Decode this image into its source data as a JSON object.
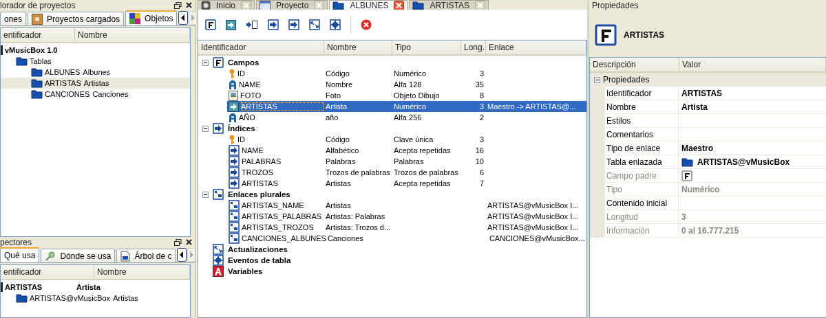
{
  "explorer": {
    "title": "lorador de proyectos",
    "tabs": [
      {
        "label": "ones",
        "selected": false,
        "kind": "plain"
      },
      {
        "label": "Proyectos cargados",
        "selected": false,
        "kind": "box"
      },
      {
        "label": "Objetos",
        "selected": true,
        "kind": "objects"
      }
    ],
    "columns": [
      "entificador",
      "Nombre"
    ],
    "tree": [
      {
        "label": "vMusicBox 1.0",
        "kind": "project",
        "selected": false,
        "children": [
          {
            "label": "Tablas",
            "kind": "folder",
            "selected": false,
            "children": [
              {
                "label": "ALBUNES",
                "name": "Albunes",
                "kind": "folder",
                "selected": false
              },
              {
                "label": "ARTISTAS",
                "name": "Artistas",
                "kind": "folder",
                "selected": true
              },
              {
                "label": "CANCIONES",
                "name": "Canciones",
                "kind": "folder",
                "selected": false
              }
            ]
          }
        ]
      }
    ]
  },
  "inspector": {
    "title": "pectores",
    "tabs": [
      {
        "label": "Qué usa",
        "selected": true,
        "kind": "plain"
      },
      {
        "label": "Dónde se usa",
        "selected": false,
        "kind": "magnifier"
      },
      {
        "label": "Árbol de c",
        "selected": false,
        "kind": "document"
      }
    ],
    "columns": [
      "entificador",
      "Nombre"
    ],
    "tree": [
      {
        "label": "ARTISTAS",
        "name": "Artista",
        "kind": "project",
        "selected": false,
        "children": [
          {
            "label": "ARTISTAS@vMusicBox",
            "name": "Artistas",
            "kind": "folder",
            "selected": false
          }
        ]
      }
    ]
  },
  "editor": {
    "tabs": [
      {
        "label": "Inicio",
        "selected": false,
        "kind": "home"
      },
      {
        "label": "Proyecto",
        "selected": false,
        "kind": "window"
      },
      {
        "label": "ALBUNES",
        "selected": true,
        "kind": "folder"
      },
      {
        "label": "ARTISTAS",
        "selected": false,
        "kind": "folder"
      }
    ],
    "columns": [
      "Identificador",
      "Nombre",
      "Tipo",
      "Long.",
      "Enlace"
    ],
    "groups": [
      {
        "label": "Campos",
        "kind": "fields",
        "rows": [
          {
            "id": "ID",
            "name": "Código",
            "type": "Numérico",
            "length": "3",
            "kind": "key",
            "selected": false
          },
          {
            "id": "NAME",
            "name": "Nombre",
            "type": "Alfa 128",
            "length": "35",
            "kind": "alpha",
            "selected": false
          },
          {
            "id": "FOTO",
            "name": "Foto",
            "type": "Objeto Dibujo",
            "length": "8",
            "kind": "picture",
            "selected": false
          },
          {
            "id": "ARTISTAS",
            "name": "Artista",
            "type": "Numérico",
            "length": "3",
            "link": "Maestro -> ARTISTAS@...",
            "kind": "link",
            "selected": true
          },
          {
            "id": "AÑO",
            "name": "año",
            "type": "Alfa 256",
            "length": "2",
            "kind": "alpha",
            "selected": false
          }
        ]
      },
      {
        "label": "Índices",
        "kind": "index",
        "rows": [
          {
            "id": "ID",
            "name": "Código",
            "type": "Clave única",
            "length": "3",
            "kind": "key",
            "selected": false
          },
          {
            "id": "NAME",
            "name": "Alfabético",
            "type": "Acepta repetidas",
            "length": "16",
            "kind": "index",
            "selected": false
          },
          {
            "id": "PALABRAS",
            "name": "Palabras",
            "type": "Palabras",
            "length": "10",
            "kind": "index",
            "selected": false
          },
          {
            "id": "TROZOS",
            "name": "Trozos de palabras",
            "type": "Trozos de palabras",
            "length": "6",
            "kind": "index",
            "selected": false
          },
          {
            "id": "ARTISTAS",
            "name": "Artistas",
            "type": "Acepta repetidas",
            "length": "7",
            "kind": "index",
            "selected": false
          }
        ]
      },
      {
        "label": "Enlaces plurales",
        "kind": "plural",
        "rows": [
          {
            "id": "ARTISTAS_NAME",
            "name": "Artistas",
            "link": "ARTISTAS@vMusicBox I...",
            "kind": "plural",
            "selected": false
          },
          {
            "id": "ARTISTAS_PALABRAS",
            "name": "Artistas: Palabras",
            "link": "ARTISTAS@vMusicBox I...",
            "kind": "plural",
            "selected": false
          },
          {
            "id": "ARTISTAS_TROZOS",
            "name": "Artistas: Trozos d...",
            "link": "ARTISTAS@vMusicBox I...",
            "kind": "plural",
            "selected": false
          },
          {
            "id": "CANCIONES_ALBUNES",
            "name": "Canciones",
            "link": "CANCIONES@vMusicBox...",
            "kind": "plural",
            "selected": false
          }
        ]
      },
      {
        "label": "Actualizaciones",
        "kind": "updates"
      },
      {
        "label": "Eventos de tabla",
        "kind": "events"
      },
      {
        "label": "Variables",
        "kind": "variables"
      }
    ]
  },
  "properties": {
    "title": "Propiedades",
    "heading": "ARTISTAS",
    "columns": [
      "Descripción",
      "Valor"
    ],
    "group": {
      "label": "Propiedades",
      "rows": [
        {
          "label": "Identificador",
          "value": "ARTISTAS",
          "kind": "text",
          "disabled": false
        },
        {
          "label": "Nombre",
          "value": "Artista",
          "kind": "text",
          "disabled": false
        },
        {
          "label": "Estilos",
          "kind": "text",
          "disabled": false
        },
        {
          "label": "Comentarios",
          "kind": "text",
          "disabled": false
        },
        {
          "label": "Tipo de enlace",
          "value": "Maestro",
          "kind": "text",
          "disabled": false
        },
        {
          "label": "Tabla enlazada",
          "value": "ARTISTAS@vMusicBox",
          "kind": "table",
          "disabled": false
        },
        {
          "label": "Campo padre",
          "kind": "field",
          "disabled": true
        },
        {
          "label": "Tipo",
          "value": "Numérico",
          "kind": "text",
          "disabled": true
        },
        {
          "label": "Contenido inicial",
          "kind": "text",
          "disabled": false
        },
        {
          "label": "Longitud",
          "value": "3",
          "kind": "text",
          "disabled": true
        },
        {
          "label": "Información",
          "value": "0 al 16.777.215",
          "kind": "text",
          "disabled": true
        }
      ]
    }
  }
}
